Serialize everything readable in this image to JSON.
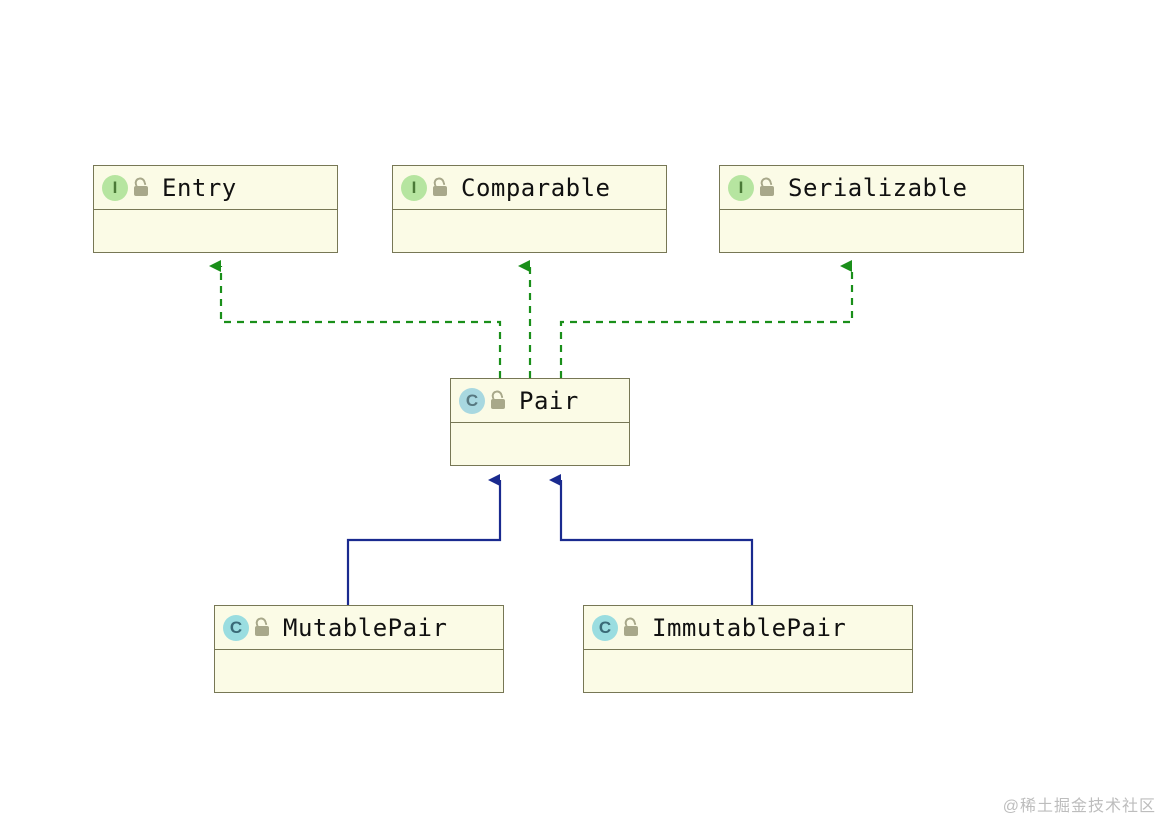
{
  "nodes": {
    "entry": {
      "name": "Entry",
      "kind": "interface",
      "badge": "I"
    },
    "comparable": {
      "name": "Comparable",
      "kind": "interface",
      "badge": "I"
    },
    "serializable": {
      "name": "Serializable",
      "kind": "interface",
      "badge": "I"
    },
    "pair": {
      "name": "Pair",
      "kind": "abstract-class",
      "badge": "C"
    },
    "mutablepair": {
      "name": "MutablePair",
      "kind": "class",
      "badge": "C"
    },
    "immutablepair": {
      "name": "ImmutablePair",
      "kind": "class",
      "badge": "C"
    }
  },
  "edges": [
    {
      "from": "pair",
      "to": "entry",
      "type": "implements"
    },
    {
      "from": "pair",
      "to": "comparable",
      "type": "implements"
    },
    {
      "from": "pair",
      "to": "serializable",
      "type": "implements"
    },
    {
      "from": "mutablepair",
      "to": "pair",
      "type": "extends"
    },
    {
      "from": "immutablepair",
      "to": "pair",
      "type": "extends"
    }
  ],
  "colors": {
    "box_fill": "#fbfbe6",
    "box_border": "#777755",
    "implements_line": "#1a8f1a",
    "extends_line": "#1a2a8f",
    "interface_badge": "#b6e5a0",
    "class_badge": "#9adde0"
  },
  "watermark": "@稀土掘金技术社区"
}
